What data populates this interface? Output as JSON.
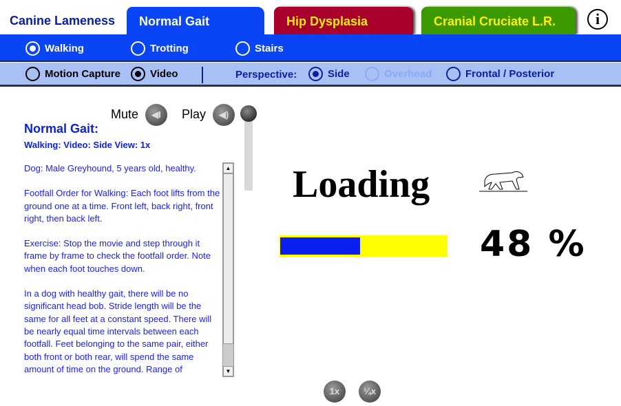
{
  "header": {
    "app_title": "Canine Lameness",
    "tabs": [
      {
        "label": "Normal Gait",
        "active": true,
        "color": "#0a45f5"
      },
      {
        "label": "Hip Dysplasia",
        "active": false,
        "color": "#a8002a"
      },
      {
        "label": "Cranial Cruciate L.R.",
        "active": false,
        "color": "#3c9a00"
      }
    ],
    "info_icon": "i"
  },
  "gait_options": [
    {
      "label": "Walking",
      "selected": true
    },
    {
      "label": "Trotting",
      "selected": false
    },
    {
      "label": "Stairs",
      "selected": false
    }
  ],
  "media_options": [
    {
      "label": "Motion Capture",
      "selected": false
    },
    {
      "label": "Video",
      "selected": true
    }
  ],
  "perspective": {
    "label": "Perspective:",
    "options": [
      {
        "label": "Side",
        "selected": true,
        "enabled": true
      },
      {
        "label": "Overhead",
        "selected": false,
        "enabled": false
      },
      {
        "label": "Frontal / Posterior",
        "selected": false,
        "enabled": true
      }
    ]
  },
  "controls": {
    "mute_label": "Mute",
    "play_label": "Play",
    "speed_buttons": [
      "1x",
      "¼x"
    ]
  },
  "info_panel": {
    "title": "Normal Gait:",
    "subtitle": "Walking: Video: Side View: 1x",
    "paragraphs": [
      "Dog: Male Greyhound, 5 years old, healthy.",
      "Footfall Order for Walking: Each foot lifts from the ground one at a time. Front left, back right, front right, then back left.",
      "Exercise: Stop the movie and step through it frame by frame to check the footfall order. Note when each foot touches down.",
      "In a dog with healthy gait, there will be no significant head bob. Stride length will be the same for all feet at a constant speed. There will be nearly equal time intervals between each footfall. Feet belonging to the same pair, either both front or both rear, will spend the same amount of time on the ground. Range of"
    ]
  },
  "loader": {
    "label": "Loading",
    "percent_text": "48 %",
    "progress": 0.48,
    "fill_color": "#0a1ff0",
    "track_color": "#ffff00"
  }
}
